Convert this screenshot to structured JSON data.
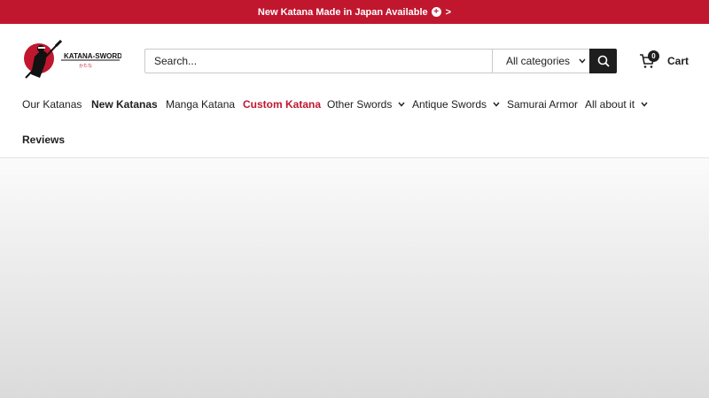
{
  "announcement": {
    "text": "New Katana Made in Japan Available",
    "arrow": ">"
  },
  "logo": {
    "name": "KATANA-SWORD",
    "subtitle": "かたな"
  },
  "search": {
    "placeholder": "Search...",
    "category": "All categories"
  },
  "cart": {
    "count": "0",
    "label": "Cart"
  },
  "nav": {
    "our_katanas": "Our Katanas",
    "new_katanas": "New Katanas",
    "manga_katana": "Manga Katana",
    "custom_katana": "Custom Katana",
    "other_swords": "Other Swords",
    "antique_swords": "Antique Swords",
    "samurai_armor": "Samurai Armor",
    "all_about_it": "All about it",
    "reviews": "Reviews"
  },
  "colors": {
    "brand": "#c0172f",
    "dark": "#1e1e1e"
  },
  "icons": [
    "plus-circle-icon",
    "search-icon",
    "chevron-down-icon",
    "shopping-bag-icon",
    "samurai-logo-icon"
  ]
}
